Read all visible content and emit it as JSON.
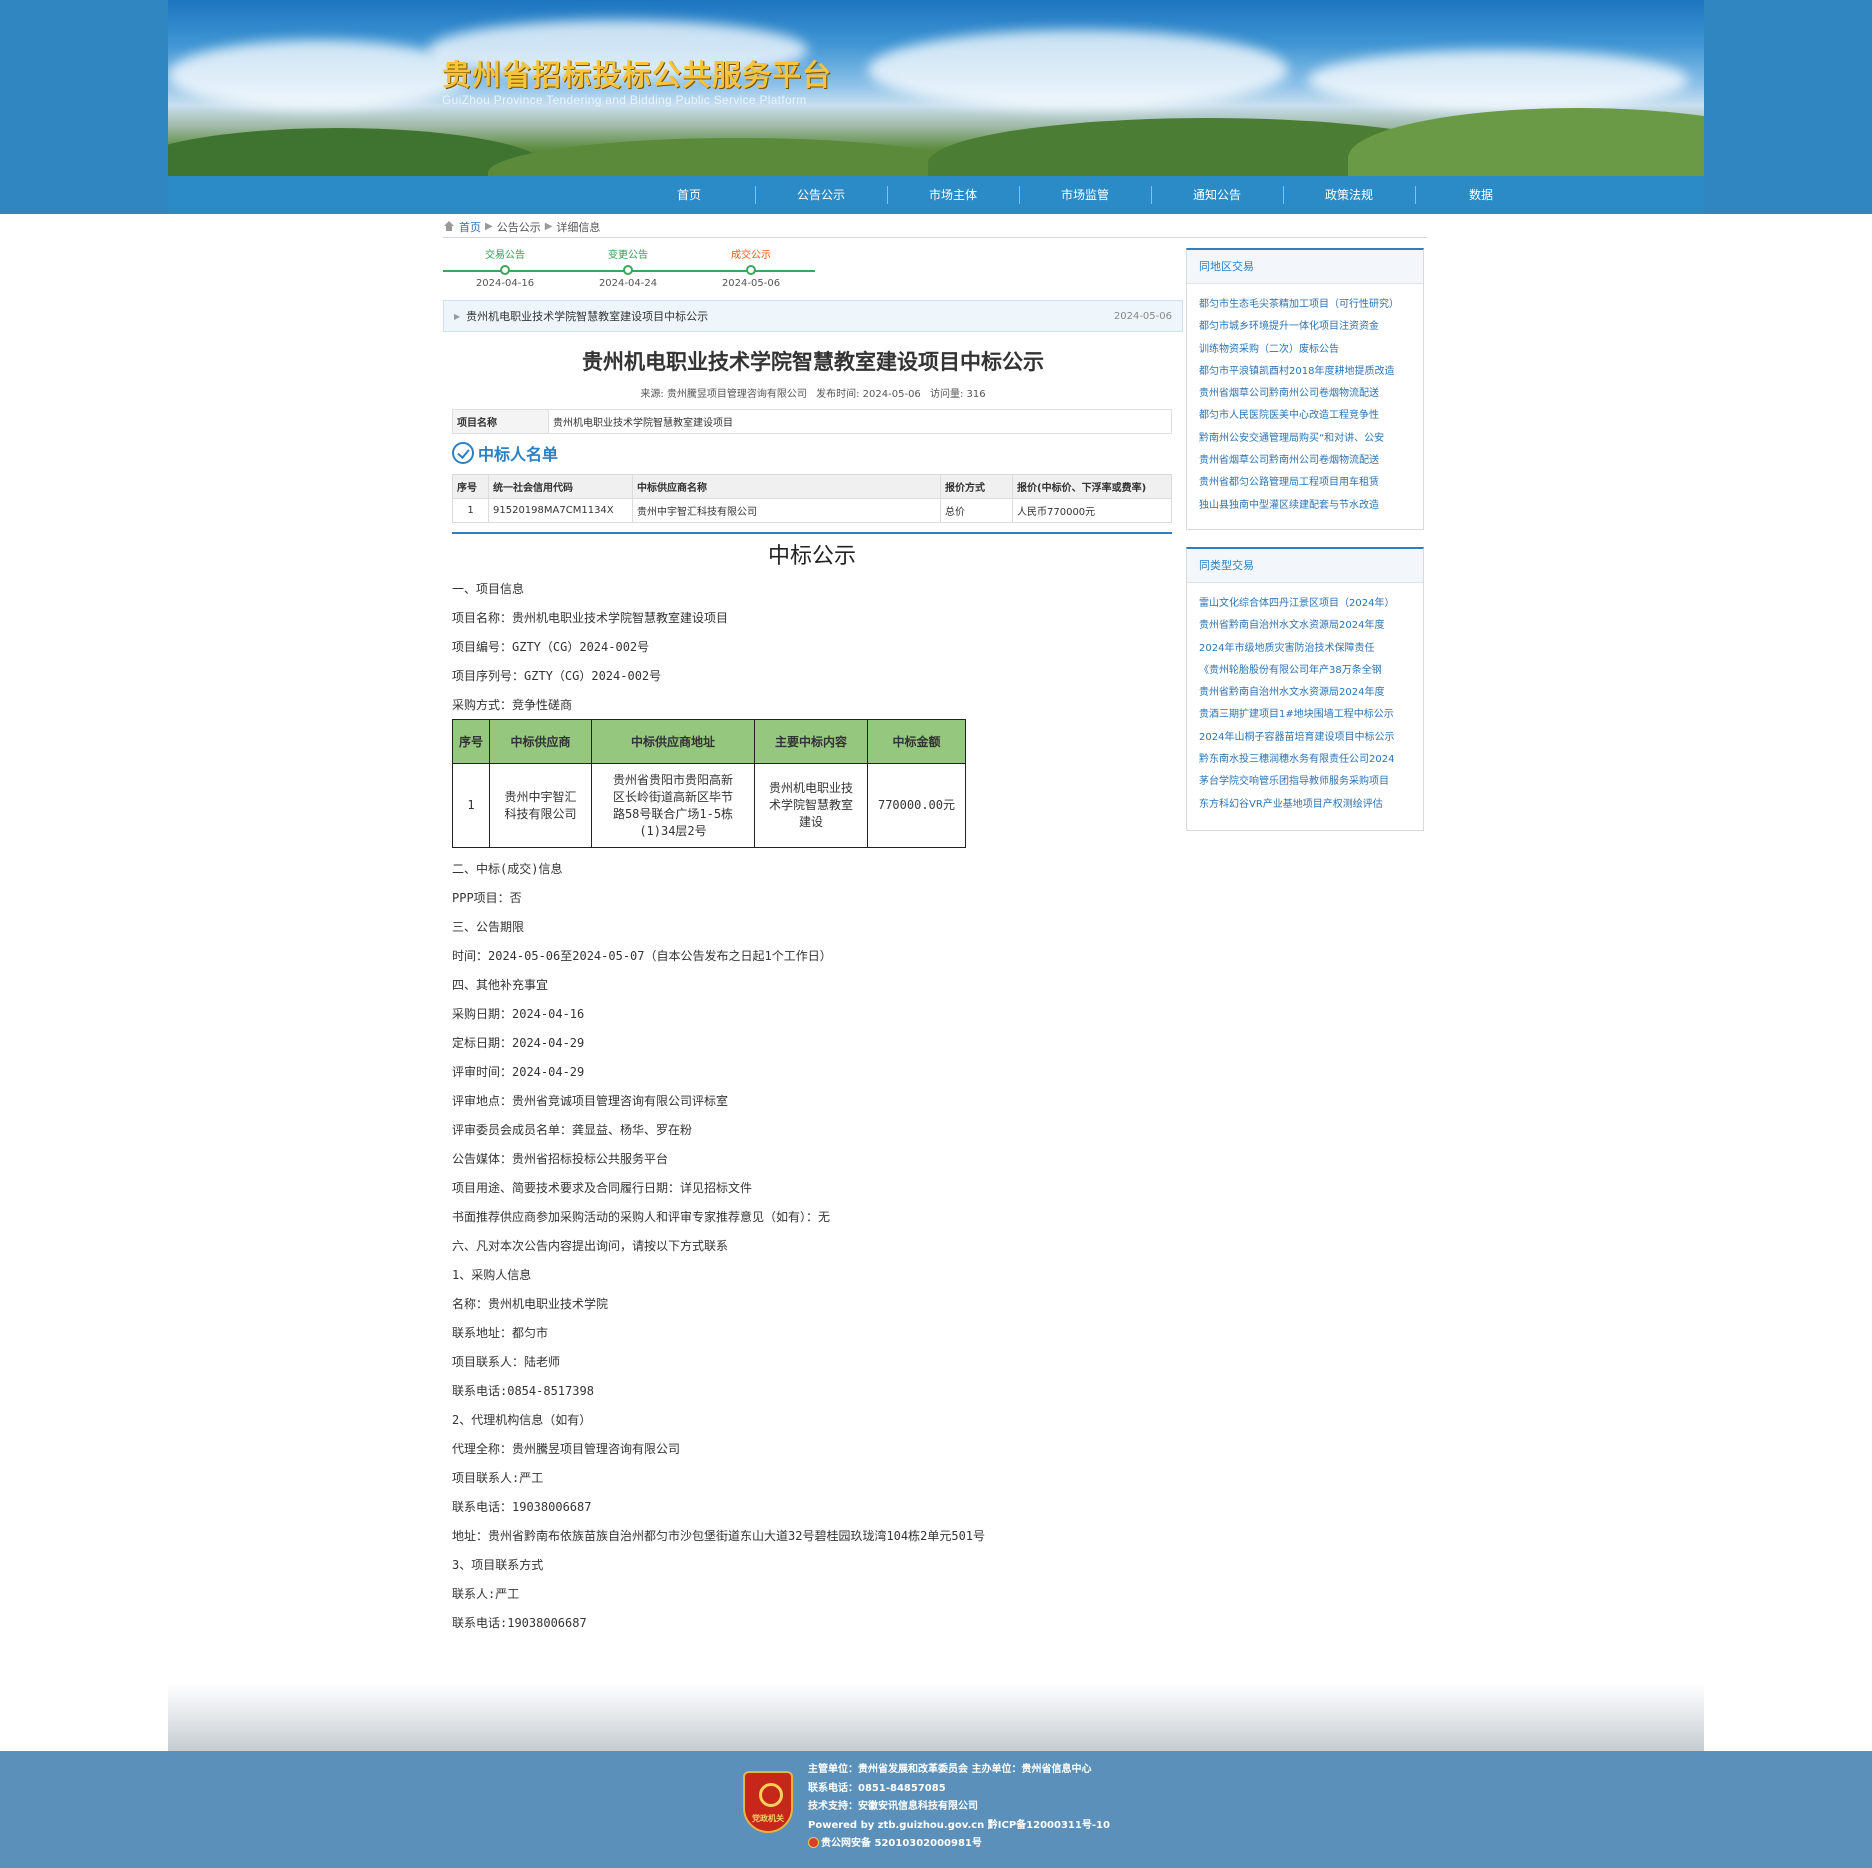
{
  "header": {
    "title": "贵州省招标投标公共服务平台",
    "subtitle": "GuiZhou Province Tendering and Bidding Public Service Platform"
  },
  "nav": [
    "首页",
    "公告公示",
    "市场主体",
    "市场监管",
    "通知公告",
    "政策法规",
    "数据"
  ],
  "breadcrumb": {
    "home": "首页",
    "level1": "公告公示",
    "level2": "详细信息"
  },
  "timeline": [
    {
      "label": "交易公告",
      "date": "2024-04-16",
      "color": "#2e9e4f"
    },
    {
      "label": "变更公告",
      "date": "2024-04-24",
      "color": "#2e9e4f"
    },
    {
      "label": "成交公示",
      "date": "2024-05-06",
      "color": "#e25a16"
    }
  ],
  "title_bar": {
    "text": "贵州机电职业技术学院智慧教室建设项目中标公示",
    "date": "2024-05-06"
  },
  "article": {
    "title": "贵州机电职业技术学院智慧教室建设项目中标公示",
    "source": "来源: 贵州騰昱项目管理咨询有限公司",
    "published": "发布时间: 2024-05-06",
    "views": "访问量: 316"
  },
  "project_row": {
    "key": "项目名称",
    "value": "贵州机电职业技术学院智慧教室建设项目"
  },
  "winners": {
    "heading": "中标人名单",
    "headers": [
      "序号",
      "统一社会信用代码",
      "中标供应商名称",
      "报价方式",
      "报价(中标价、下浮率或费率)"
    ],
    "rows": [
      [
        "1",
        "91520198MA7CM1134X",
        "贵州中宇智汇科技有限公司",
        "总价",
        "人民币770000元"
      ]
    ]
  },
  "notice": {
    "title": "中标公示",
    "lines_before_table": [
      "一、项目信息",
      "项目名称：贵州机电职业技术学院智慧教室建设项目",
      "项目编号：GZTY（CG）2024-002号",
      "项目序列号：GZTY（CG）2024-002号",
      "采购方式：竞争性磋商"
    ],
    "table_headers": [
      "序号",
      "中标供应商",
      "中标供应商地址",
      "主要中标内容",
      "中标金额"
    ],
    "table_row": {
      "no": "1",
      "supplier_l1": "贵州中宇智汇",
      "supplier_l2": "科技有限公司",
      "addr_l1": "贵州省贵阳市贵阳高新",
      "addr_l2": "区长岭街道高新区毕节",
      "addr_l3": "路58号联合广场1-5栋",
      "addr_l4": "(1)34层2号",
      "content_l1": "贵州机电职业技",
      "content_l2": "术学院智慧教室",
      "content_l3": "建设",
      "amount": "770000.00元"
    },
    "lines_after_table": [
      "二、中标(成交)信息",
      "PPP项目：否",
      "三、公告期限",
      "时间：2024-05-06至2024-05-07（自本公告发布之日起1个工作日）",
      "四、其他补充事宜",
      "采购日期：2024-04-16",
      "定标日期：2024-04-29",
      "评审时间：2024-04-29",
      "评审地点：贵州省竞诚项目管理咨询有限公司评标室",
      "评审委员会成员名单：龚显益、杨华、罗在粉",
      "公告媒体：贵州省招标投标公共服务平台",
      "项目用途、简要技术要求及合同履行日期：详见招标文件",
      "书面推荐供应商参加采购活动的采购人和评审专家推荐意见（如有）：无",
      "六、凡对本次公告内容提出询问，请按以下方式联系",
      "1、采购人信息",
      "名称：贵州机电职业技术学院",
      "联系地址：都匀市",
      "项目联系人：陆老师",
      "联系电话:0854-8517398",
      "2、代理机构信息（如有）",
      "代理全称：贵州騰昱项目管理咨询有限公司",
      "项目联系人:严工",
      "联系电话：19038006687",
      "地址：贵州省黔南布依族苗族自治州都匀市沙包堡街道东山大道32号碧桂园玖珑湾104栋2单元501号",
      "3、项目联系方式",
      "联系人:严工",
      "联系电话:19038006687"
    ]
  },
  "sidebar": {
    "same_region": {
      "heading": "同地区交易",
      "items": [
        "都匀市生态毛尖茶精加工项目（可行性研究）",
        "都匀市城乡环境提升一体化项目注资资金",
        "训练物资采购（二次）废标公告",
        "都匀市平浪镇凯酉村2018年度耕地提质改造",
        "贵州省烟草公司黔南州公司卷烟物流配送",
        "都匀市人民医院医美中心改造工程竞争性",
        "黔南州公安交通管理局购买“和对讲、公安",
        "贵州省烟草公司黔南州公司卷烟物流配送",
        "贵州省都匀公路管理局工程项目用车租赁",
        "独山县独南中型灌区续建配套与节水改造"
      ]
    },
    "same_type": {
      "heading": "同类型交易",
      "items": [
        "雷山文化综合体四丹江景区项目（2024年）",
        "贵州省黔南自治州水文水资源局2024年度",
        "2024年市级地质灾害防治技术保障责任",
        "《贵州轮胎股份有限公司年产38万条全钢",
        "贵州省黔南自治州水文水资源局2024年度",
        "贵酒三期扩建项目1#地块围墙工程中标公示",
        "2024年山桐子容器苗培育建设项目中标公示",
        "黔东南水投三穗润穗水务有限责任公司2024",
        "茅台学院交响管乐团指导教师服务采购项目",
        "东方科幻谷VR产业基地项目产权测绘评估"
      ]
    }
  },
  "footer": {
    "emblem_label": "党政机关",
    "line1": "主管单位：贵州省发展和改革委员会   主办单位：贵州省信息中心",
    "line2": "联系电话：0851-84857085",
    "line3": "技术支持：安徽安讯信息科技有限公司",
    "line4": "Powered by ztb.guizhou.gov.cn   黔ICP备12000311号-10",
    "line5": "贵公网安备 52010302000981号"
  }
}
